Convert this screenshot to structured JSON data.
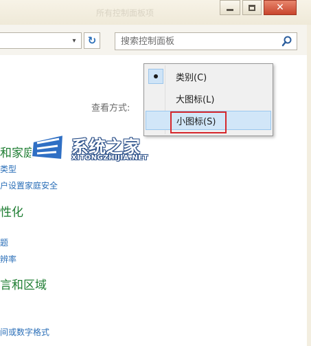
{
  "window": {
    "title": "所有控制面板项",
    "minimize_glyph": "",
    "close_glyph": "✕"
  },
  "address": {
    "dropdown_glyph": "▾",
    "refresh_glyph": "↻"
  },
  "search": {
    "placeholder": "搜索控制面板",
    "icon": "magnifier-icon"
  },
  "toolbar": {
    "view_label": "查看方式:",
    "view_value": "类别",
    "view_arrow": "▾"
  },
  "categories": [
    {
      "title": "和家庭安全",
      "links": [
        "类型",
        "户设置家庭安全"
      ]
    },
    {
      "title": "性化",
      "links": []
    },
    {
      "title": "",
      "links": [
        "题",
        "辨率"
      ]
    },
    {
      "title": "言和区域",
      "links": [
        "间或数字格式"
      ]
    }
  ],
  "menu": {
    "items": [
      {
        "label": "类别(C)",
        "selected": true
      },
      {
        "label": "大图标(L)",
        "selected": false
      },
      {
        "label": "小图标(S)",
        "selected": false,
        "hovered": true
      }
    ]
  },
  "watermark": {
    "name": "系统之家",
    "url": "XITONGZHIJIA.NET"
  },
  "colors": {
    "link": "#2b6fb8",
    "category": "#1e7d32",
    "highlight": "#d6262b"
  }
}
